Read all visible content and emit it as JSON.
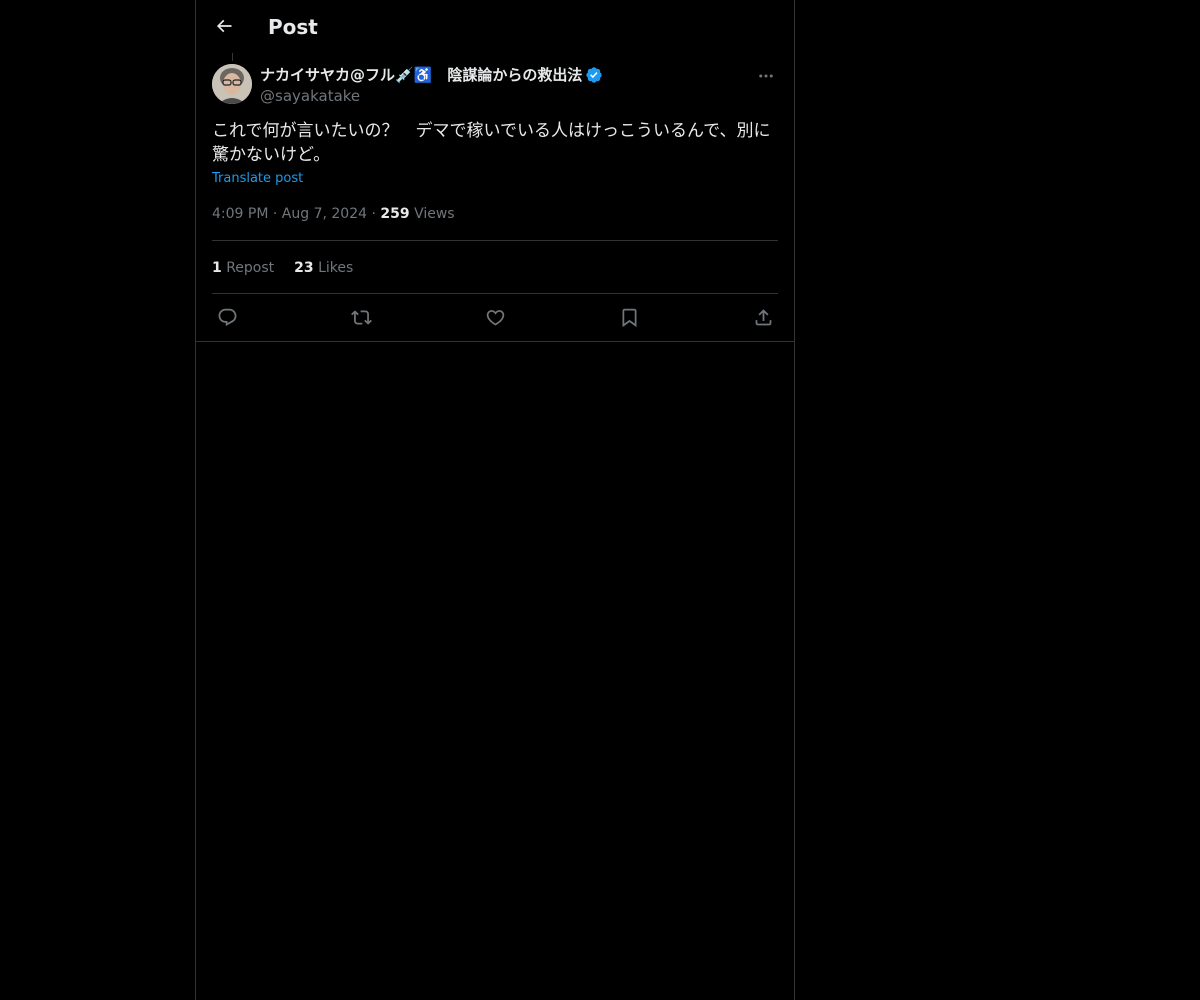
{
  "header": {
    "title": "Post"
  },
  "post": {
    "author": {
      "display_name": "ナカイサヤカ@フル💉♿️　陰謀論からの救出法",
      "handle": "@sayakatake",
      "verified": true
    },
    "text": "これで何が言いたいの？　デマで稼いでいる人はけっこういるんで、別に驚かないけど。",
    "translate_label": "Translate post",
    "time": "4:09 PM",
    "date": "Aug 7, 2024",
    "views_count": "259",
    "views_label": "Views",
    "separator": "·",
    "stats": {
      "reposts_count": "1",
      "reposts_label": "Repost",
      "likes_count": "23",
      "likes_label": "Likes"
    },
    "icons": {
      "back": "arrow-left-icon",
      "more": "more-horizontal-icon",
      "verified": "verified-badge-icon",
      "reply": "reply-icon",
      "repost": "repost-icon",
      "like": "heart-icon",
      "bookmark": "bookmark-icon",
      "share": "share-icon"
    }
  },
  "colors": {
    "background": "#000000",
    "text_primary": "#e7e9ea",
    "text_secondary": "#71767b",
    "accent": "#1d9bf0",
    "border": "#2f3336"
  }
}
